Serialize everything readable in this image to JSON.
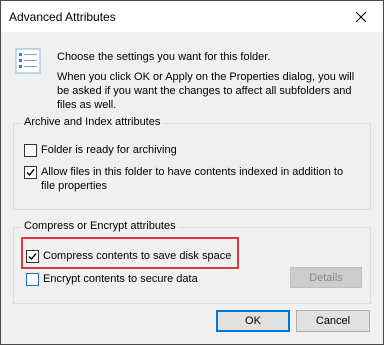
{
  "dialog": {
    "title": "Advanced Attributes",
    "intro_line1": "Choose the settings you want for this folder.",
    "intro_line2": "When you click OK or Apply on the Properties dialog, you will be asked if you want the changes to affect all subfolders and files as well."
  },
  "archive_group": {
    "label": "Archive and Index attributes",
    "folder_ready_label": "Folder is ready for archiving",
    "folder_ready_checked": false,
    "allow_index_label": "Allow files in this folder to have contents indexed in addition to file properties",
    "allow_index_checked": true
  },
  "compress_group": {
    "label": "Compress or Encrypt attributes",
    "compress_label": "Compress contents to save disk space",
    "compress_checked": true,
    "encrypt_label": "Encrypt contents to secure data",
    "encrypt_checked": false,
    "details_label": "Details"
  },
  "buttons": {
    "ok": "OK",
    "cancel": "Cancel"
  },
  "colors": {
    "highlight": "#e0393e",
    "accent": "#0078d7"
  },
  "icons": {
    "close": "close-icon",
    "info": "settings-list-icon",
    "checkmark": "checkmark-icon"
  }
}
